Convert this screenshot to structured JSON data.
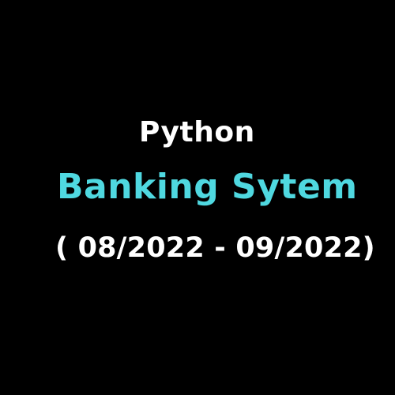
{
  "title": {
    "language": "Python",
    "project": "Banking Sytem",
    "date_range": "( 08/2022 - 09/2022)"
  },
  "colors": {
    "background": "#000000",
    "primary_text": "#ffffff",
    "accent": "#4fd8e0"
  }
}
